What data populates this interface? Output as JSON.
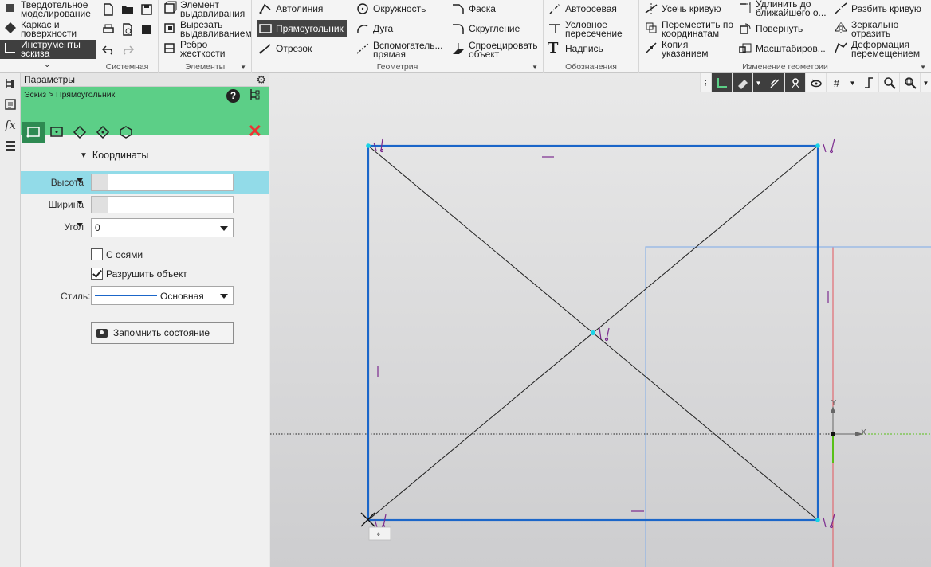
{
  "ribbon": {
    "modes": [
      {
        "label": "Твердотельное моделирование",
        "l1": "Твердотельное",
        "l2": "моделирование",
        "active": false
      },
      {
        "label": "Каркас и поверхности",
        "l1": "Каркас и",
        "l2": "поверхности",
        "active": false
      },
      {
        "label": "Инструменты эскиза",
        "l1": "Инструменты",
        "l2": "эскиза",
        "active": true
      }
    ],
    "sections": {
      "system": "Системная",
      "elements": "Элементы",
      "geometry": "Геометрия",
      "designations": "Обозначения",
      "geometry_edit": "Изменение геометрии"
    },
    "elements": {
      "extrude": {
        "l1": "Элемент",
        "l2": "выдавливания"
      },
      "cut_extrude": {
        "l1": "Вырезать",
        "l2": "выдавливанием"
      },
      "rib": {
        "l1": "Ребро",
        "l2": "жесткости"
      }
    },
    "geometry": {
      "autoline": "Автолиния",
      "rectangle": "Прямоугольник",
      "segment": "Отрезок",
      "circle": "Окружность",
      "arc": "Дуга",
      "aux_line": {
        "l1": "Вспомогатель...",
        "l2": "прямая"
      },
      "chamfer": "Фаска",
      "fillet": "Скругление",
      "project": {
        "l1": "Спроецировать",
        "l2": "объект"
      }
    },
    "designations": {
      "auto_axis": "Автоосевая",
      "conditional_intersection": {
        "l1": "Условное",
        "l2": "пересечение"
      },
      "text": "Надпись"
    },
    "geometry_edit": {
      "trim": "Усечь кривую",
      "move_coords": {
        "l1": "Переместить по",
        "l2": "координатам"
      },
      "copy": {
        "l1": "Копия",
        "l2": "указанием"
      },
      "extend": {
        "l1": "Удлинить до",
        "l2": "ближайшего о..."
      },
      "rotate": "Повернуть",
      "scale": "Масштабиров...",
      "split": "Разбить кривую",
      "mirror": {
        "l1": "Зеркально",
        "l2": "отразить"
      },
      "deform": {
        "l1": "Деформация",
        "l2": "перемещением"
      }
    }
  },
  "panel": {
    "title": "Параметры",
    "breadcrumb": "Эскиз > Прямоугольник",
    "section": "Координаты",
    "height_label": "Высота",
    "height_value": "",
    "width_label": "Ширина",
    "width_value": "",
    "angle_label": "Угол",
    "angle_value": "0",
    "with_axes_label": "С осями",
    "with_axes_checked": false,
    "destroy_label": "Разрушить объект",
    "destroy_checked": true,
    "style_label": "Стиль:",
    "style_value": "Основная",
    "save_state_label": "Запомнить состояние"
  },
  "viewport": {
    "axis_x": "X",
    "axis_y": "Y"
  },
  "colors": {
    "accent_green": "#5ccf87",
    "sketch_blue": "#1b66c9",
    "constraint_purple": "#7b2a8e",
    "point_cyan": "#19d3e6"
  }
}
